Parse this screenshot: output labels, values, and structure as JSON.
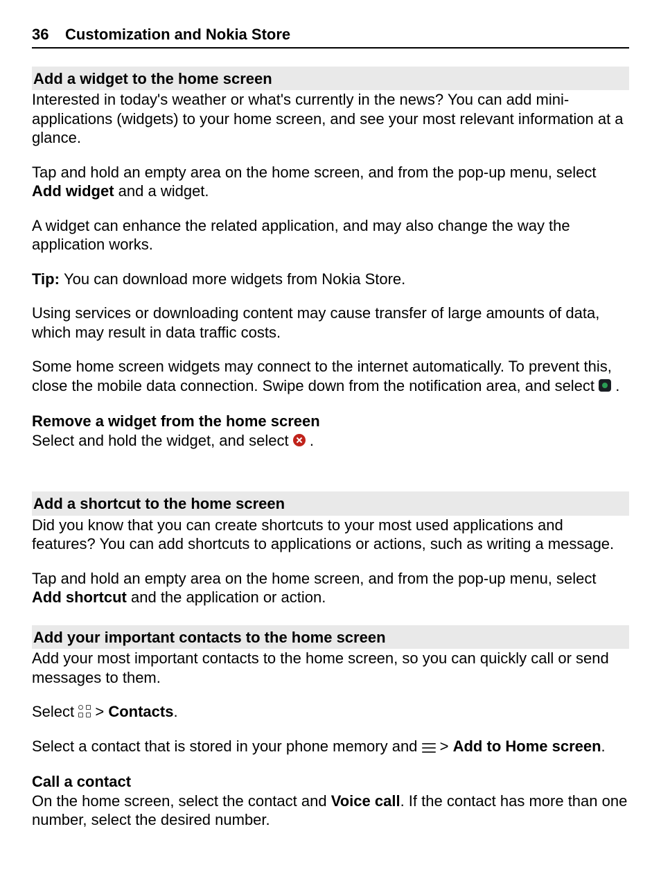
{
  "header": {
    "page_number": "36",
    "title": "Customization and Nokia Store"
  },
  "s1": {
    "heading": "Add a widget to the home screen",
    "p1": "Interested in today's weather or what's currently in the news? You can add mini-applications (widgets) to your home screen, and see your most relevant information at a glance.",
    "p2_a": "Tap and hold an empty area on the home screen, and from the pop-up menu, select ",
    "p2_bold": "Add widget",
    "p2_b": " and a widget.",
    "p3": "A widget can enhance the related application, and may also change the way the application works.",
    "p4_tip": "Tip: ",
    "p4_rest": "You can download more widgets from Nokia Store.",
    "p5": "Using services or downloading content may cause transfer of large amounts of data, which may result in data traffic costs.",
    "p6_a": "Some home screen widgets may connect to the internet automatically. To prevent this, close the mobile data connection. Swipe down from the notification area, and select ",
    "p6_b": " .",
    "sub1": "Remove a widget from the home screen",
    "sub1_p_a": "Select and hold the widget, and select ",
    "sub1_p_b": " ."
  },
  "s2": {
    "heading": "Add a shortcut to the home screen",
    "p1": "Did you know that you can create shortcuts to your most used applications and features? You can add shortcuts to applications or actions, such as writing a message.",
    "p2_a": "Tap and hold an empty area on the home screen, and from the pop-up menu, select ",
    "p2_bold": "Add shortcut",
    "p2_b": " and the application or action."
  },
  "s3": {
    "heading": "Add your important contacts to the home screen",
    "p1": "Add your most important contacts to the home screen, so you can quickly call or send messages to them.",
    "p2_a": "Select ",
    "p2_b": "  > ",
    "p2_bold": "Contacts",
    "p2_c": ".",
    "p3_a": "Select a contact that is stored in your phone memory and ",
    "p3_b": "  > ",
    "p3_bold": "Add to Home screen",
    "p3_c": ".",
    "sub1": "Call a contact",
    "sub1_p_a": "On the home screen, select the contact and ",
    "sub1_p_bold": "Voice call",
    "sub1_p_b": ". If the contact has more than one number, select the desired number."
  }
}
